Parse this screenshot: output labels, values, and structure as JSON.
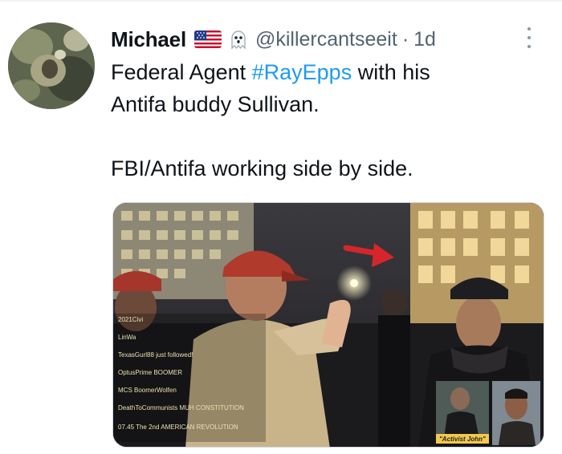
{
  "tweet": {
    "display_name": "Michael",
    "handle": "@killercantseeit",
    "separator": "·",
    "time": "1d",
    "text_line1_prefix": "Federal Agent ",
    "hashtag": "#RayEpps",
    "text_line1_suffix": " with his",
    "text_line2": "Antifa buddy Sullivan.",
    "text_line3": "FBI/Antifa working side by side.",
    "badges": [
      "us-flag-emoji",
      "ghost-emoji"
    ]
  },
  "media": {
    "chat_overlay": [
      "2021Civi",
      "LinWa",
      "TexasGurl88 just followed!",
      "OptusPrime BOOMER",
      "MCS BoomerWolfen",
      "DeathToCommunists MUH CONSTITUTION",
      "07.45 The 2nd AMERICAN REVOLUTION"
    ],
    "inset_caption": "\"Activist John\"",
    "colors": {
      "arrow": "#d6262b",
      "caption_bg": "#f2c94c"
    }
  },
  "colors": {
    "link": "#1d9bf0",
    "secondary": "#536471",
    "border": "#cfd9de"
  }
}
